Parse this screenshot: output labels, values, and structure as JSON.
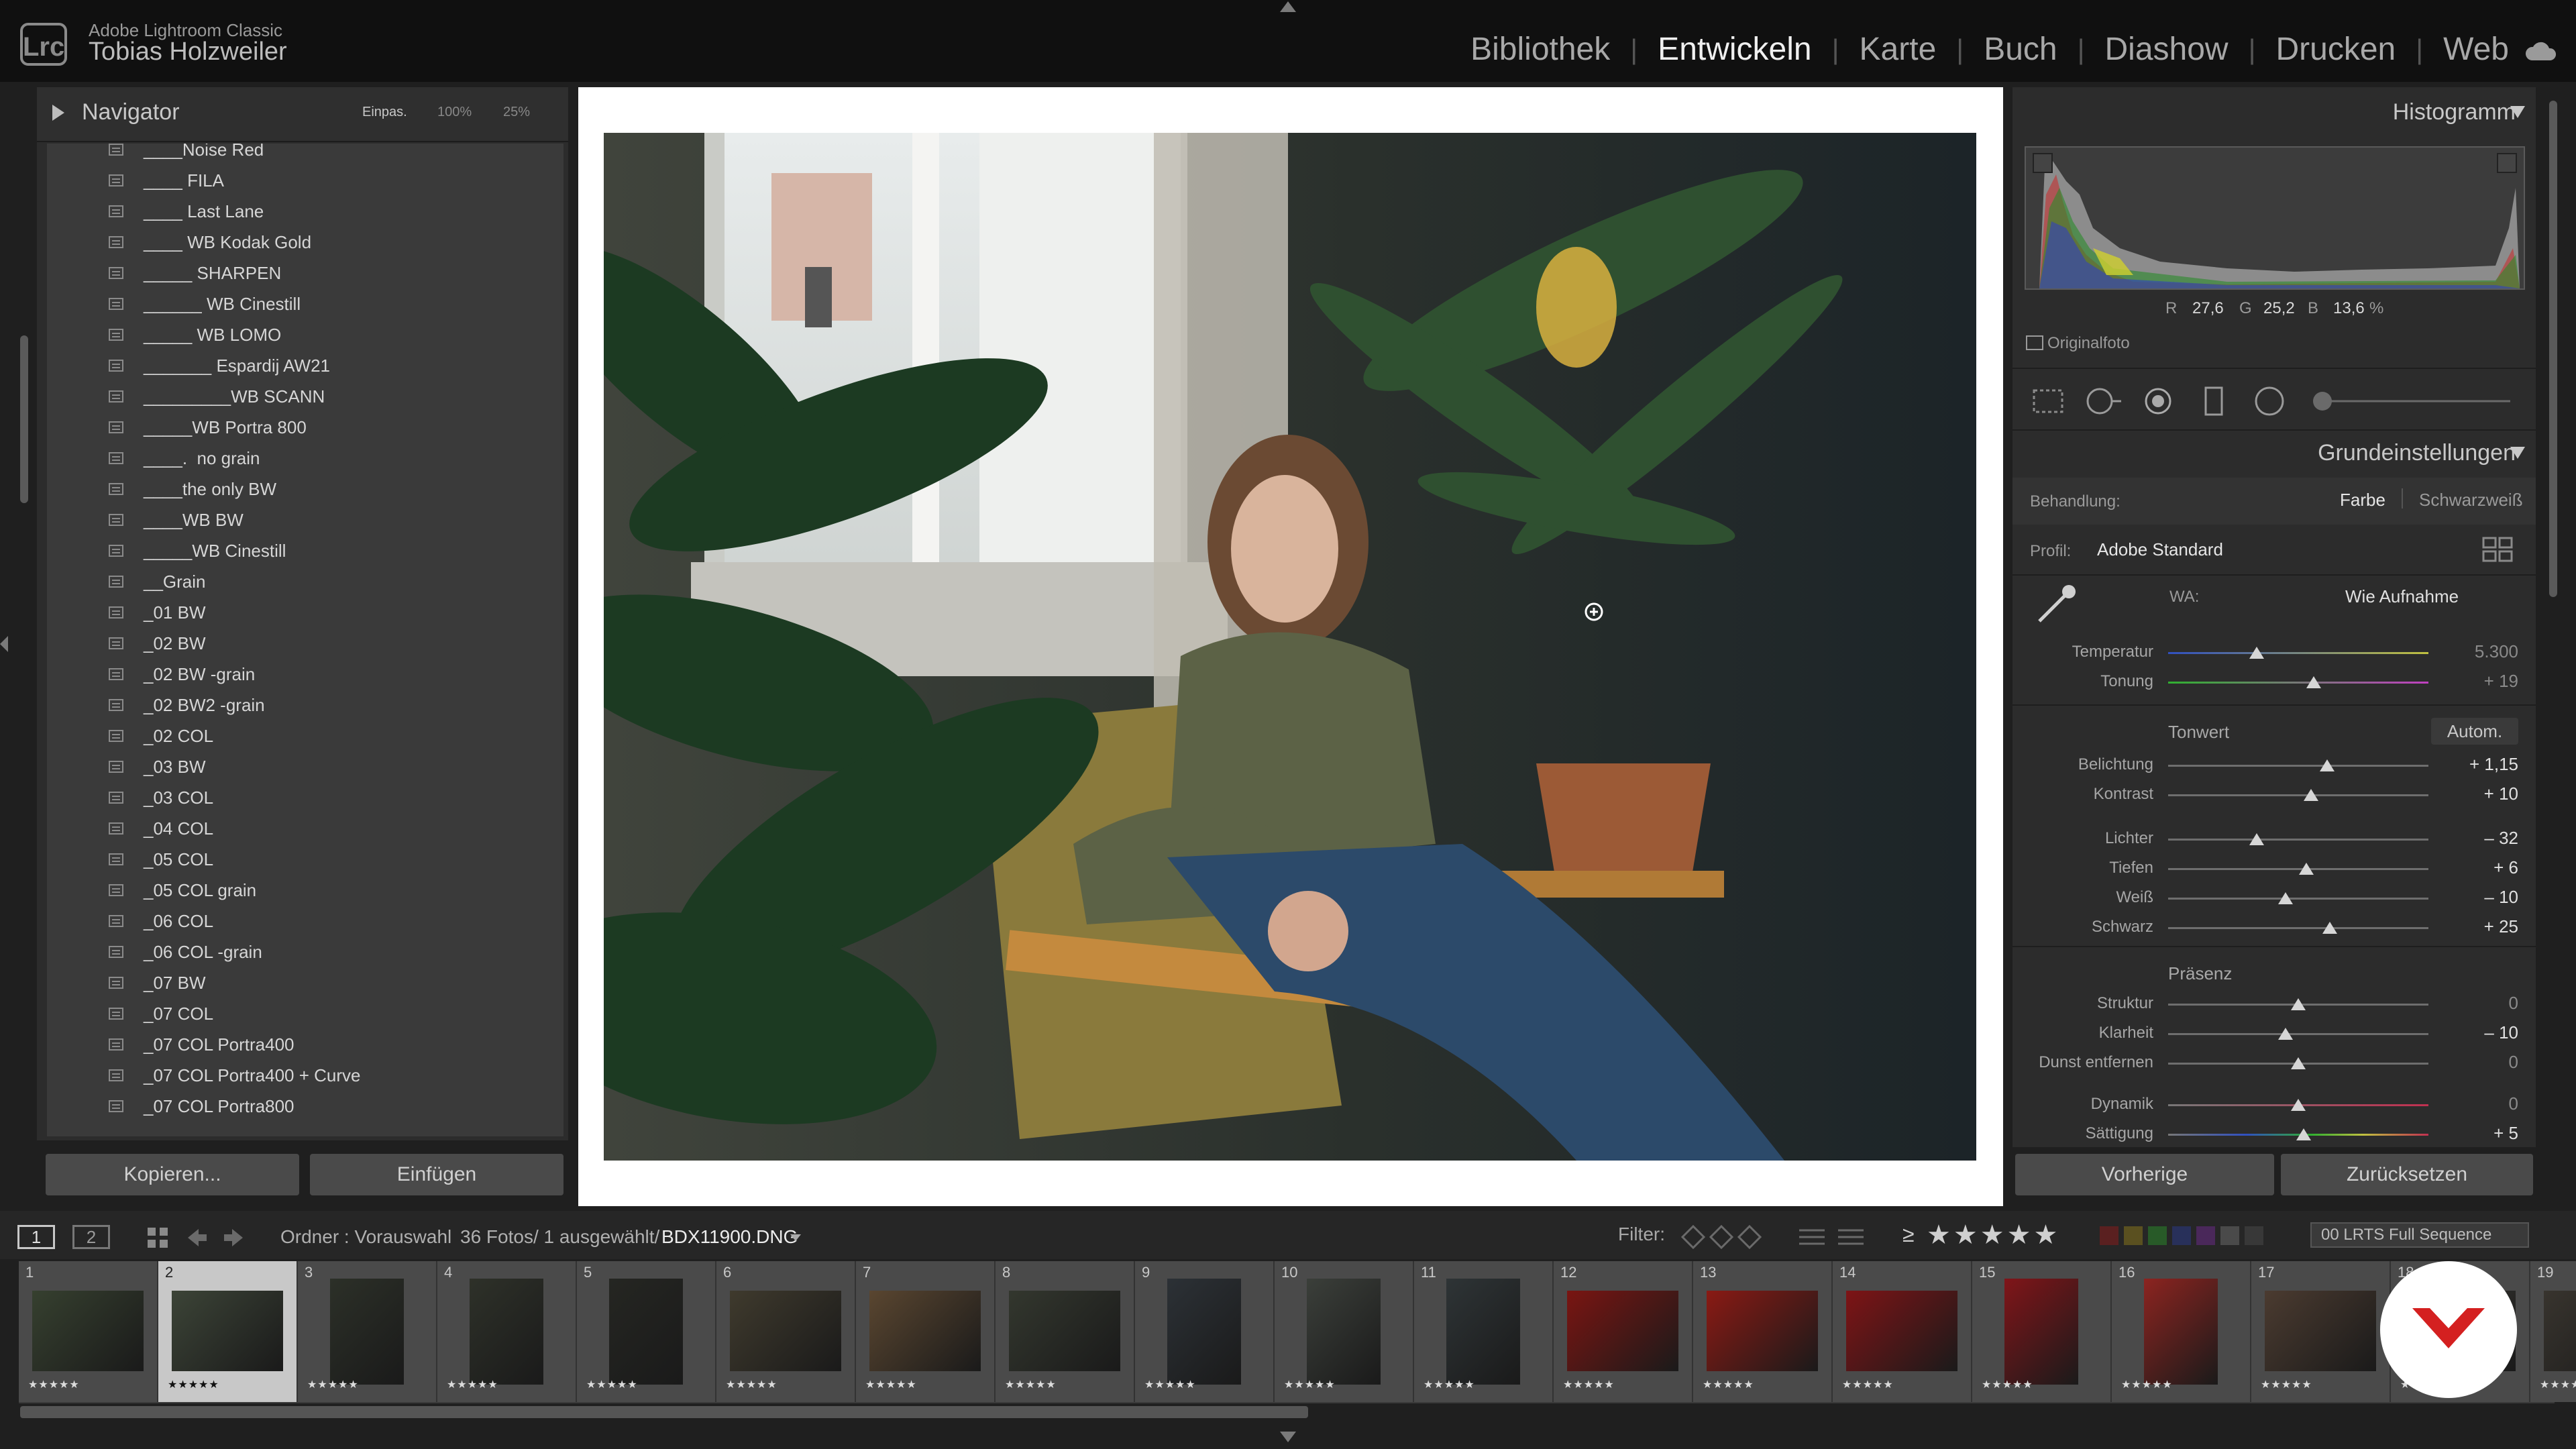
{
  "app": {
    "name": "Adobe Lightroom Classic",
    "user": "Tobias Holzweiler",
    "logo": "Lrc"
  },
  "modules": [
    {
      "label": "Bibliothek",
      "active": false
    },
    {
      "label": "Entwickeln",
      "active": true
    },
    {
      "label": "Karte",
      "active": false
    },
    {
      "label": "Buch",
      "active": false
    },
    {
      "label": "Diashow",
      "active": false
    },
    {
      "label": "Drucken",
      "active": false
    },
    {
      "label": "Web",
      "active": false
    }
  ],
  "navigator": {
    "title": "Navigator",
    "fit": "Einpas.",
    "z1": "100%",
    "z2": "25%"
  },
  "presets": [
    "____Noise Red",
    "____ FILA",
    "____ Last Lane",
    "____ WB Kodak Gold",
    "_____ SHARPEN",
    "______ WB Cinestill",
    "_____ WB LOMO",
    "_______ Espardij AW21",
    "_________WB SCANN",
    "_____WB Portra 800",
    "____.  no grain",
    "____the only BW",
    "____WB BW",
    "_____WB Cinestill",
    "__Grain",
    "_01 BW",
    "_02 BW",
    "_02 BW -grain",
    "_02 BW2 -grain",
    "_02 COL",
    "_03 BW",
    "_03 COL",
    "_04 COL",
    "_05 COL",
    "_05 COL grain",
    "_06 COL",
    "_06 COL -grain",
    "_07 BW",
    "_07 COL",
    "_07 COL Portra400",
    "_07 COL Portra400 + Curve",
    "_07 COL Portra800"
  ],
  "left_buttons": {
    "copy": "Kopieren...",
    "paste": "Einfügen"
  },
  "histogram": {
    "title": "Histogramm",
    "r_label": "R",
    "r": "27,6",
    "g_label": "G",
    "g": "25,2",
    "b_label": "B",
    "b": "13,6",
    "pct": "%",
    "original": "Originalfoto"
  },
  "basic": {
    "title": "Grundeinstellungen",
    "treatment_label": "Behandlung:",
    "color": "Farbe",
    "bw": "Schwarzweiß",
    "profile_label": "Profil:",
    "profile": "Adobe Standard",
    "wb_label": "WA:",
    "wb": "Wie Aufnahme",
    "tone_label": "Tonwert",
    "auto": "Autom.",
    "presence_label": "Präsenz"
  },
  "sliders": [
    {
      "label": "Temperatur",
      "value": "5.300",
      "pos": 0.34,
      "dim": true,
      "track": "temp"
    },
    {
      "label": "Tonung",
      "value": "+ 19",
      "pos": 0.56,
      "dim": true,
      "track": "tint"
    },
    {
      "label": "Belichtung",
      "value": "+ 1,15",
      "pos": 0.61,
      "dim": false,
      "track": "plain"
    },
    {
      "label": "Kontrast",
      "value": "+ 10",
      "pos": 0.55,
      "dim": false,
      "track": "plain"
    },
    {
      "label": "Lichter",
      "value": "– 32",
      "pos": 0.34,
      "dim": false,
      "track": "plain"
    },
    {
      "label": "Tiefen",
      "value": "+ 6",
      "pos": 0.53,
      "dim": false,
      "track": "plain"
    },
    {
      "label": "Weiß",
      "value": "– 10",
      "pos": 0.45,
      "dim": false,
      "track": "plain"
    },
    {
      "label": "Schwarz",
      "value": "+ 25",
      "pos": 0.62,
      "dim": false,
      "track": "plain"
    },
    {
      "label": "Struktur",
      "value": "0",
      "pos": 0.5,
      "dim": true,
      "track": "plain"
    },
    {
      "label": "Klarheit",
      "value": "– 10",
      "pos": 0.45,
      "dim": false,
      "track": "plain"
    },
    {
      "label": "Dunst entfernen",
      "value": "0",
      "pos": 0.5,
      "dim": true,
      "track": "plain"
    },
    {
      "label": "Dynamik",
      "value": "0",
      "pos": 0.5,
      "dim": true,
      "track": "vib"
    },
    {
      "label": "Sättigung",
      "value": "+ 5",
      "pos": 0.52,
      "dim": false,
      "track": "sat"
    }
  ],
  "right_buttons": {
    "prev": "Vorherige",
    "reset": "Zurücksetzen"
  },
  "filmbar": {
    "view1": "1",
    "view2": "2",
    "folder": "Ordner : Vorauswahl",
    "count": "36 Fotos/ 1 ausgewählt/",
    "file": "BDX11900.DNG",
    "filter": "Filter:",
    "rating_op": "≥",
    "rating_stars": "★★★★★",
    "sequence": "00 LRTS Full Sequence"
  },
  "filmstrip": [
    {
      "n": "1",
      "tone": "#36402f"
    },
    {
      "n": "2",
      "tone": "#3c4437"
    },
    {
      "n": "3",
      "tone": "#2c3028"
    },
    {
      "n": "4",
      "tone": "#2e3129"
    },
    {
      "n": "5",
      "tone": "#252622"
    },
    {
      "n": "6",
      "tone": "#3f3a2d"
    },
    {
      "n": "7",
      "tone": "#5a4630"
    },
    {
      "n": "8",
      "tone": "#33372e"
    },
    {
      "n": "9",
      "tone": "#2c3136"
    },
    {
      "n": "10",
      "tone": "#3b3f3a"
    },
    {
      "n": "11",
      "tone": "#2e3436"
    },
    {
      "n": "12",
      "tone": "#7a1512"
    },
    {
      "n": "13",
      "tone": "#8a1a14"
    },
    {
      "n": "14",
      "tone": "#7e1416"
    },
    {
      "n": "15",
      "tone": "#801519"
    },
    {
      "n": "16",
      "tone": "#8c2420"
    },
    {
      "n": "17",
      "tone": "#4b3b30"
    },
    {
      "n": "18",
      "tone": "#3b3a35"
    },
    {
      "n": "19",
      "tone": "#38342e"
    }
  ],
  "stars": "★★★★★"
}
